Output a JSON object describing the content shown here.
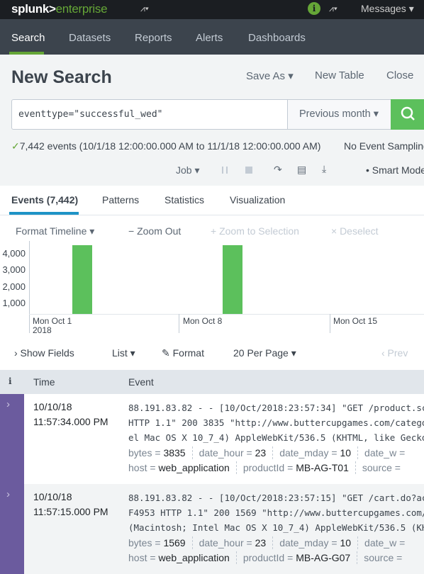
{
  "topbar": {
    "logo": "splunk>enterprise",
    "logo_a": "splunk>",
    "logo_b": "enterprise",
    "info_icon": "i",
    "messages": "Messages ▾",
    "activity": "⩘▾"
  },
  "nav": {
    "items": [
      "Search",
      "Datasets",
      "Reports",
      "Alerts",
      "Dashboards"
    ],
    "active": "Search"
  },
  "header": {
    "title": "New Search",
    "save_as": "Save As ▾",
    "new_table": "New Table",
    "close": "Close"
  },
  "search": {
    "query": "eventtype=\"successful_wed\"",
    "time_range": "Previous month ▾"
  },
  "status": {
    "check": "✓",
    "summary": "7,442 events (10/1/18 12:00:00.000 AM to 11/1/18 12:00:00.000 AM)",
    "sampling": "No Event Sampling"
  },
  "job": {
    "job": "Job ▾",
    "smart_mode": "Smart Mode"
  },
  "tabs": [
    "Events (7,442)",
    "Patterns",
    "Statistics",
    "Visualization"
  ],
  "timeline": {
    "format": "Format Timeline ▾",
    "zoom_out": "− Zoom Out",
    "zoom_sel": "+ Zoom to Selection",
    "deselect": "× Deselect",
    "y_ticks": [
      "4,000",
      "3,000",
      "2,000",
      "1,000"
    ],
    "dates": [
      "Mon Oct 1",
      "Mon Oct 8",
      "Mon Oct 15"
    ],
    "year": "2018",
    "bars": [
      {
        "day": "Wed Oct 3",
        "count": 4150
      },
      {
        "day": "Wed Oct 10",
        "count": 4150
      }
    ],
    "bar_color": "#5cc05c"
  },
  "controls": {
    "show_fields": "› Show Fields",
    "list": "List ▾",
    "format": "Format",
    "per_page": "20 Per Page ▾",
    "prev": "‹ Prev"
  },
  "table": {
    "headers": {
      "info": "i",
      "time": "Time",
      "event": "Event"
    },
    "rows": [
      {
        "date": "10/10/18",
        "time": "11:57:34.000 PM",
        "lines": [
          "88.191.83.82 - - [10/Oct/2018:23:57:34] \"GET /product.sc",
          "HTTP 1.1\" 200 3835 \"http://www.buttercupgames.com/catego",
          "el Mac OS X 10_7_4) AppleWebKit/536.5 (KHTML, like Gecko"
        ],
        "f1": [
          [
            "bytes",
            "3835"
          ],
          [
            "date_hour",
            "23"
          ],
          [
            "date_mday",
            "10"
          ],
          [
            "date_w",
            ""
          ]
        ],
        "f2": [
          [
            "host",
            "web_application"
          ],
          [
            "productId",
            "MB-AG-T01"
          ],
          [
            "source",
            ""
          ]
        ]
      },
      {
        "date": "10/10/18",
        "time": "11:57:15.000 PM",
        "lines": [
          "88.191.83.82 - - [10/Oct/2018:23:57:15] \"GET /cart.do?ac",
          "F4953 HTTP 1.1\" 200 1569 \"http://www.buttercupgames.com/",
          "(Macintosh; Intel Mac OS X 10_7_4) AppleWebKit/536.5 (KH"
        ],
        "f1": [
          [
            "bytes",
            "1569"
          ],
          [
            "date_hour",
            "23"
          ],
          [
            "date_mday",
            "10"
          ],
          [
            "date_w",
            ""
          ]
        ],
        "f2": [
          [
            "host",
            "web_application"
          ],
          [
            "productId",
            "MB-AG-G07"
          ],
          [
            "source",
            ""
          ]
        ]
      }
    ]
  },
  "colors": {
    "accent": "#65a637",
    "row_bar": "#6b5b9e",
    "tab_underline": "#1e93c6"
  }
}
